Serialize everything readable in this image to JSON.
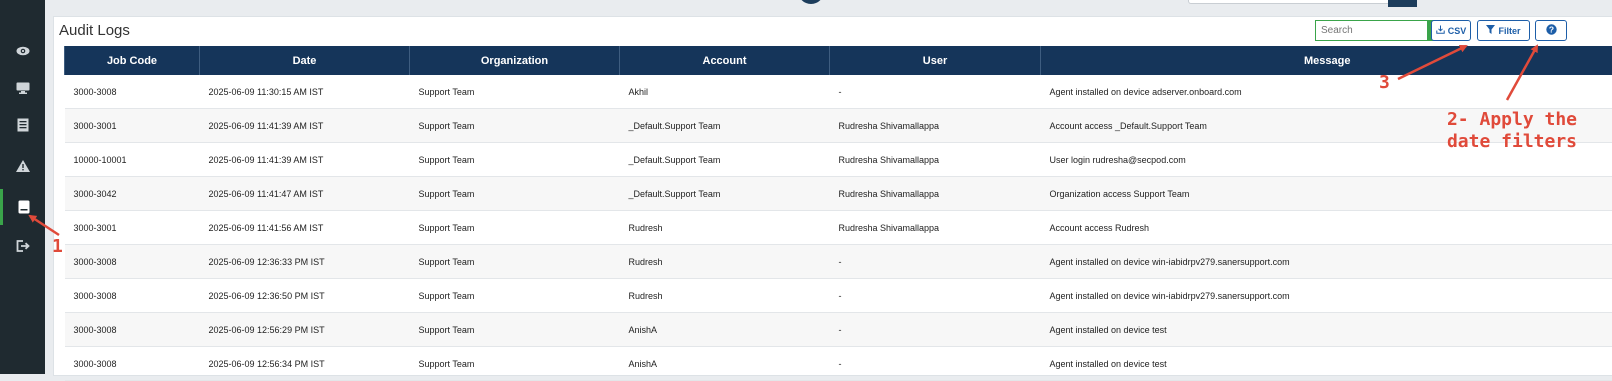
{
  "colors": {
    "sidebar_bg": "#1f2a30",
    "table_header_bg": "#15355a",
    "accent_green": "#3aa44a",
    "button_blue": "#1d5ea8",
    "annotation_red": "#e04a3a"
  },
  "sidebar": {
    "items": [
      {
        "icon": "eye-icon"
      },
      {
        "icon": "monitor-icon"
      },
      {
        "icon": "report-icon"
      },
      {
        "icon": "alert-icon"
      },
      {
        "icon": "audit-log-icon",
        "active": true
      },
      {
        "icon": "logout-icon"
      }
    ]
  },
  "page": {
    "title": "Audit Logs"
  },
  "toolbar": {
    "search_placeholder": "Search",
    "csv_label": "CSV",
    "filter_label": "Filter"
  },
  "table": {
    "columns": [
      "Job Code",
      "Date",
      "Organization",
      "Account",
      "User",
      "Message"
    ],
    "rows": [
      [
        "3000-3008",
        "2025-06-09 11:30:15 AM IST",
        "Support Team",
        "Akhil",
        "-",
        "Agent installed on device adserver.onboard.com"
      ],
      [
        "3000-3001",
        "2025-06-09 11:41:39 AM IST",
        "Support Team",
        "_Default.Support Team",
        "Rudresha Shivamallappa",
        "Account access _Default.Support Team"
      ],
      [
        "10000-10001",
        "2025-06-09 11:41:39 AM IST",
        "Support Team",
        "_Default.Support Team",
        "Rudresha Shivamallappa",
        "User login rudresha@secpod.com"
      ],
      [
        "3000-3042",
        "2025-06-09 11:41:47 AM IST",
        "Support Team",
        "_Default.Support Team",
        "Rudresha Shivamallappa",
        "Organization access Support Team"
      ],
      [
        "3000-3001",
        "2025-06-09 11:41:56 AM IST",
        "Support Team",
        "Rudresh",
        "Rudresha Shivamallappa",
        "Account access Rudresh"
      ],
      [
        "3000-3008",
        "2025-06-09 12:36:33 PM IST",
        "Support Team",
        "Rudresh",
        "-",
        "Agent installed on device win-iabidrpv279.sanersupport.com"
      ],
      [
        "3000-3008",
        "2025-06-09 12:36:50 PM IST",
        "Support Team",
        "Rudresh",
        "-",
        "Agent installed on device win-iabidrpv279.sanersupport.com"
      ],
      [
        "3000-3008",
        "2025-06-09 12:56:29 PM IST",
        "Support Team",
        "AnishA",
        "-",
        "Agent installed on device test"
      ],
      [
        "3000-3008",
        "2025-06-09 12:56:34 PM IST",
        "Support Team",
        "AnishA",
        "-",
        "Agent installed on device test"
      ]
    ]
  },
  "annotations": {
    "step1": "1",
    "step2_line1": "2- Apply the",
    "step2_line2": "date filters",
    "step3": "3"
  }
}
